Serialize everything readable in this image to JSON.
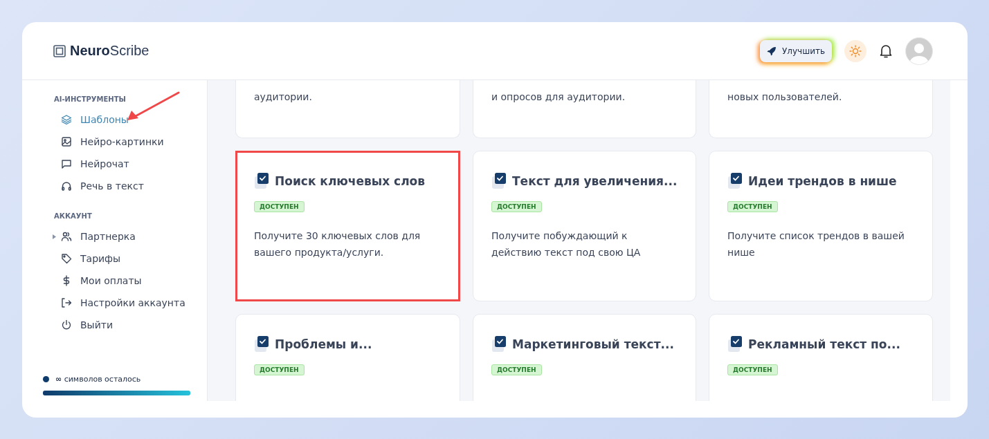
{
  "header": {
    "logo_bold": "Neuro",
    "logo_rest": "Scribe",
    "upgrade_button": "Улучшить"
  },
  "sidebar": {
    "sections": [
      {
        "title": "AI-ИНСТРУМЕНТЫ",
        "items": [
          {
            "label": "Шаблоны",
            "selected": true,
            "pointed": true
          },
          {
            "label": "Нейро-картинки",
            "selected": false,
            "pointed": false
          },
          {
            "label": "Нейрочат",
            "selected": false,
            "pointed": false
          },
          {
            "label": "Речь в текст",
            "selected": false,
            "pointed": false
          }
        ]
      },
      {
        "title": "АККАУНТ",
        "items": [
          {
            "label": "Партнерка",
            "selected": false,
            "pointed": false,
            "expanded": false
          },
          {
            "label": "Тарифы",
            "selected": false,
            "pointed": false
          },
          {
            "label": "Мои оплаты",
            "selected": false,
            "pointed": false
          },
          {
            "label": "Настройки аккаунта",
            "selected": false,
            "pointed": false
          },
          {
            "label": "Выйти",
            "selected": false,
            "pointed": false
          }
        ]
      }
    ],
    "balance": {
      "amount": "∞",
      "text": "символов осталось",
      "level": 1
    }
  },
  "cards": [
    {
      "kind": "partial",
      "description": "аудитории.",
      "highlighted": false
    },
    {
      "kind": "partial",
      "description": "и опросов для аудитории.",
      "highlighted": false
    },
    {
      "kind": "partial",
      "description": "новых пользователей.",
      "highlighted": false
    },
    {
      "kind": "full",
      "title": "Поиск ключевых слов",
      "badge": "ДОСТУПЕН",
      "description": "Получите 30 ключевых слов для вашего продукта/услуги.",
      "highlighted": true
    },
    {
      "kind": "full",
      "title": "Текст для увеличения...",
      "badge": "ДОСТУПЕН",
      "description": "Получите побуждающий к действию текст под свою ЦА",
      "highlighted": false
    },
    {
      "kind": "full",
      "title": "Идеи трендов в нише",
      "badge": "ДОСТУПЕН",
      "description": "Получите список трендов в вашей нише",
      "highlighted": false
    },
    {
      "kind": "full",
      "title": "Проблемы и...",
      "badge": "ДОСТУПЕН",
      "highlighted": false
    },
    {
      "kind": "full",
      "title": "Маркетинговый текст...",
      "badge": "ДОСТУПЕН",
      "highlighted": false
    },
    {
      "kind": "full",
      "title": "Рекламный текст по...",
      "badge": "ДОСТУПЕН",
      "highlighted": false
    }
  ]
}
